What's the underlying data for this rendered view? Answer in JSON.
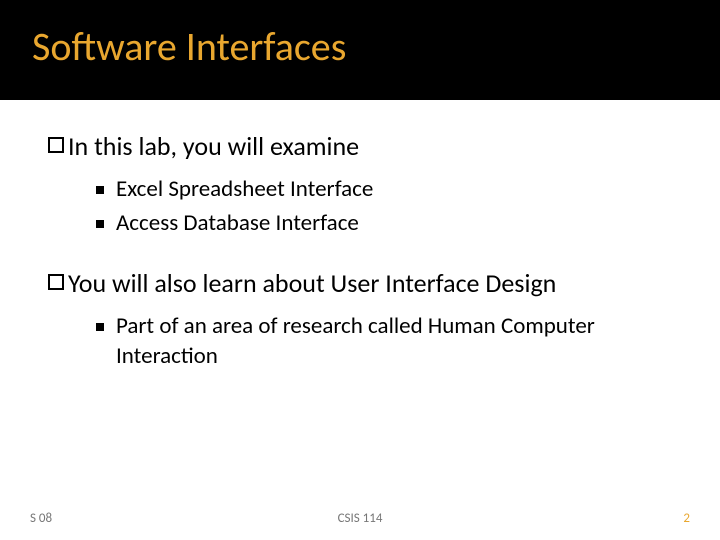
{
  "title": "Software Interfaces",
  "points": [
    {
      "text": "In this lab, you will examine",
      "sub": [
        "Excel Spreadsheet Interface",
        "Access Database Interface"
      ]
    },
    {
      "text": "You will also learn about User Interface Design",
      "sub": [
        "Part of an area of research called Human Computer Interaction"
      ]
    }
  ],
  "footer": {
    "left": "S 08",
    "center": "CSIS 114",
    "right": "2"
  }
}
